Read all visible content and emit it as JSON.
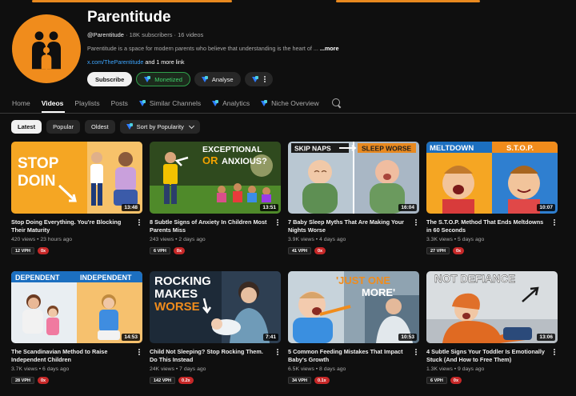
{
  "channel": {
    "name": "Parentitude",
    "handle": "@Parentitude",
    "subscribers": "18K subscribers",
    "videos_count": "16 videos",
    "description": "Parentitude is a space for modern parents who believe that understanding is the heart of ...",
    "description_more": "...more",
    "link_url": "x.com/TheParentitude",
    "link_more": "and 1 more link",
    "buttons": {
      "subscribe": "Subscribe",
      "monetized": "Monetized",
      "analyse": "Analyse"
    }
  },
  "tabs": [
    {
      "label": "Home"
    },
    {
      "label": "Videos"
    },
    {
      "label": "Playlists"
    },
    {
      "label": "Posts"
    },
    {
      "label": "Similar Channels"
    },
    {
      "label": "Analytics"
    },
    {
      "label": "Niche Overview"
    }
  ],
  "filters": {
    "latest": "Latest",
    "popular": "Popular",
    "oldest": "Oldest",
    "sort": "Sort by Popularity"
  },
  "videos": [
    {
      "title": "Stop Doing Everything. You're Blocking Their Maturity",
      "views": "420 views",
      "age": "23 hours ago",
      "duration": "13:48",
      "vph": "12 VPH",
      "mult": "0x",
      "thumb_text": [
        "STOP",
        "DOIN"
      ]
    },
    {
      "title": "8 Subtle Signs of Anxiety In Children Most Parents Miss",
      "views": "243 views",
      "age": "2 days ago",
      "duration": "13:51",
      "vph": "6 VPH",
      "mult": "0x",
      "thumb_text": [
        "EXCEPTIONAL",
        "OR",
        "ANXIOUS?"
      ]
    },
    {
      "title": "7 Baby Sleep Myths That Are Making Your Nights Worse",
      "views": "3.9K views",
      "age": "4 days ago",
      "duration": "16:04",
      "vph": "41 VPH",
      "mult": "0x",
      "thumb_text": [
        "SKIP NAPS",
        "SLEEP WORSE"
      ]
    },
    {
      "title": "The S.T.O.P. Method That Ends Meltdowns in 60 Seconds",
      "views": "3.3K views",
      "age": "5 days ago",
      "duration": "10:07",
      "vph": "27 VPH",
      "mult": "0x",
      "thumb_text": [
        "MELTDOWN",
        "S.T.O.P."
      ]
    },
    {
      "title": "The Scandinavian Method to Raise Independent Children",
      "views": "3.7K views",
      "age": "6 days ago",
      "duration": "14:53",
      "vph": "28 VPH",
      "mult": "0x",
      "thumb_text": [
        "DEPENDENT",
        "INDEPENDENT"
      ]
    },
    {
      "title": "Child Not Sleeping? Stop Rocking Them. Do This Instead",
      "views": "24K views",
      "age": "7 days ago",
      "duration": "7:41",
      "vph": "142 VPH",
      "mult": "0.2x",
      "thumb_text": [
        "ROCKING",
        "MAKES",
        "WORSE"
      ]
    },
    {
      "title": "5 Common Feeding Mistakes That Impact Baby's Growth",
      "views": "6.5K views",
      "age": "8 days ago",
      "duration": "10:53",
      "vph": "34 VPH",
      "mult": "0.1x",
      "thumb_text": [
        "'JUST ONE",
        "MORE'"
      ]
    },
    {
      "title": "4 Subtle Signs Your Toddler Is Emotionally Stuck (And How to Free Them)",
      "views": "1.3K views",
      "age": "9 days ago",
      "duration": "13:06",
      "vph": "6 VPH",
      "mult": "0x",
      "thumb_text": [
        "NOT DEFIANCE"
      ]
    }
  ],
  "colors": {
    "brand_orange": "#f08c1c",
    "link_blue": "#3ea6ff",
    "monetized_green": "#3fd26a",
    "badge_red": "#c62828"
  }
}
